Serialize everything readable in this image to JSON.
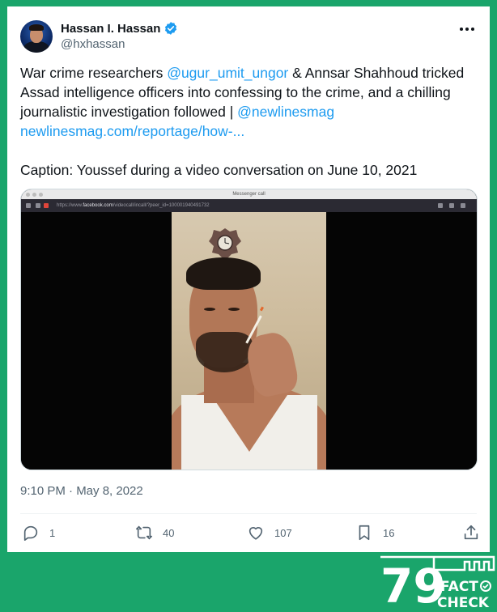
{
  "tweet": {
    "author_name": "Hassan I. Hassan",
    "handle": "@hxhassan",
    "verified": true,
    "text_intro": "War crime researchers ",
    "mention_1": "@ugur_umit_ungor",
    "text_mid": " & Annsar Shahhoud tricked Assad intelligence officers into confessing to the crime, and a chilling journalistic investigation followed | ",
    "mention_2": "@newlinesmag",
    "link": "newlinesmag.com/reportage/how-...",
    "caption": "Caption: Youssef during a video conversation on June 10, 2021",
    "timestamp": "9:10 PM · May 8, 2022",
    "replies": "1",
    "retweets": "40",
    "likes": "107",
    "bookmarks": "16"
  },
  "media": {
    "window_title": "Messenger call",
    "url_prefix": "https://www.",
    "url_domain": "facebook.com",
    "url_path": "/videocall/incall/?peer_id=100001940491732"
  },
  "badge": {
    "logo_text": "79",
    "line1": "FACT",
    "line2": "CHECK"
  },
  "colors": {
    "background_green": "#1aa56b",
    "link_blue": "#1d9bf0",
    "text_primary": "#0f1419",
    "text_secondary": "#536471"
  },
  "icons": [
    "verified-badge-icon",
    "more-icon",
    "reply-icon",
    "retweet-icon",
    "like-icon",
    "bookmark-icon",
    "share-icon"
  ]
}
